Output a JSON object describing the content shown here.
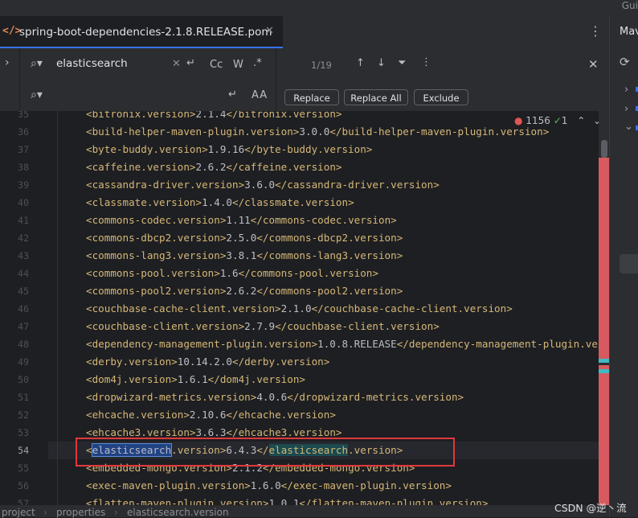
{
  "top_strip": {
    "right_text": "Gui"
  },
  "tab": {
    "icon": "</>",
    "title": "spring-boot-dependencies-2.1.8.RELEASE.pom",
    "close": "✕"
  },
  "tab_more": "⋮",
  "right_panel": {
    "title": "Mav"
  },
  "find": {
    "query": "elasticsearch",
    "counter": "1/19",
    "options": {
      "match_case": "Cc",
      "words": "W",
      "regex": ".*"
    },
    "buttons": {
      "replace": "Replace",
      "replace_all": "Replace All",
      "exclude": "Exclude"
    }
  },
  "indicators": {
    "errors": "1156",
    "ok": "1"
  },
  "editor": {
    "current_line": 54,
    "lines": [
      {
        "n": "35",
        "tag": "bitronix.version",
        "val": "2.1.4"
      },
      {
        "n": "36",
        "tag": "build-helper-maven-plugin.version",
        "val": "3.0.0"
      },
      {
        "n": "37",
        "tag": "byte-buddy.version",
        "val": "1.9.16"
      },
      {
        "n": "38",
        "tag": "caffeine.version",
        "val": "2.6.2"
      },
      {
        "n": "39",
        "tag": "cassandra-driver.version",
        "val": "3.6.0"
      },
      {
        "n": "40",
        "tag": "classmate.version",
        "val": "1.4.0"
      },
      {
        "n": "41",
        "tag": "commons-codec.version",
        "val": "1.11"
      },
      {
        "n": "42",
        "tag": "commons-dbcp2.version",
        "val": "2.5.0"
      },
      {
        "n": "43",
        "tag": "commons-lang3.version",
        "val": "3.8.1"
      },
      {
        "n": "44",
        "tag": "commons-pool.version",
        "val": "1.6"
      },
      {
        "n": "45",
        "tag": "commons-pool2.version",
        "val": "2.6.2"
      },
      {
        "n": "46",
        "tag": "couchbase-cache-client.version",
        "val": "2.1.0"
      },
      {
        "n": "47",
        "tag": "couchbase-client.version",
        "val": "2.7.9"
      },
      {
        "n": "48",
        "tag": "dependency-management-plugin.version",
        "val": "1.0.8.RELEASE"
      },
      {
        "n": "49",
        "tag": "derby.version",
        "val": "10.14.2.0"
      },
      {
        "n": "50",
        "tag": "dom4j.version",
        "val": "1.6.1"
      },
      {
        "n": "51",
        "tag": "dropwizard-metrics.version",
        "val": "4.0.6"
      },
      {
        "n": "52",
        "tag": "ehcache.version",
        "val": "2.10.6"
      },
      {
        "n": "53",
        "tag": "ehcache3.version",
        "val": "3.6.3"
      },
      {
        "n": "54",
        "tag": "elasticsearch.version",
        "val": "6.4.3"
      },
      {
        "n": "55",
        "tag": "embedded-mongo.version",
        "val": "2.1.2"
      },
      {
        "n": "56",
        "tag": "exec-maven-plugin.version",
        "val": "1.6.0"
      },
      {
        "n": "57",
        "tag": "flatten-maven-plugin.version",
        "val": "1.0.1"
      }
    ]
  },
  "breadcrumb": [
    "project",
    "properties",
    "elasticsearch.version"
  ],
  "watermark": "CSDN @逆丶流"
}
